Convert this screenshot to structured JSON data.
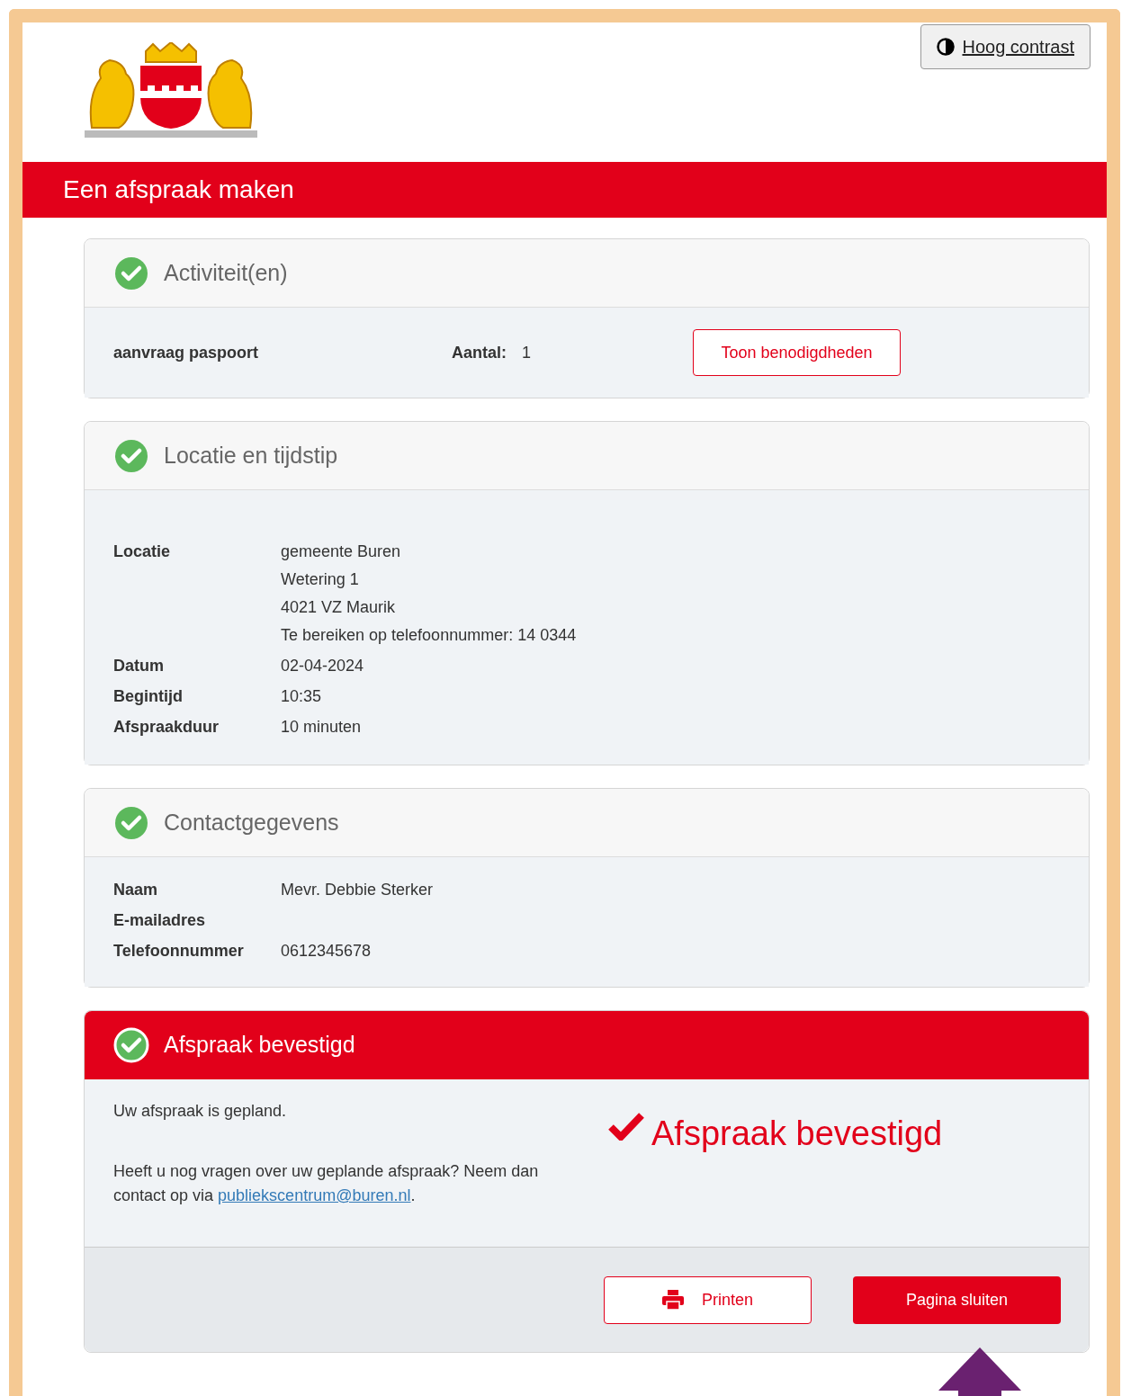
{
  "header": {
    "contrast_button": "Hoog contrast",
    "title": "Een afspraak maken"
  },
  "activity": {
    "title": "Activiteit(en)",
    "done": true,
    "items": [
      {
        "name": "aanvraag paspoort",
        "count_label": "Aantal:",
        "count": "1",
        "button": "Toon benodigdheden"
      }
    ]
  },
  "location": {
    "title": "Locatie en tijdstip",
    "done": true,
    "rows": [
      {
        "label": "Locatie",
        "lines": [
          "gemeente Buren",
          "Wetering 1",
          "4021 VZ Maurik",
          "Te bereiken op telefoonnummer: 14 0344"
        ]
      },
      {
        "label": "Datum",
        "lines": [
          "02-04-2024"
        ]
      },
      {
        "label": "Begintijd",
        "lines": [
          "10:35"
        ]
      },
      {
        "label": "Afspraakduur",
        "lines": [
          "10 minuten"
        ]
      }
    ]
  },
  "contact": {
    "title": "Contactgegevens",
    "done": true,
    "rows": [
      {
        "label": "Naam",
        "lines": [
          "Mevr. Debbie Sterker"
        ]
      },
      {
        "label": "E-mailadres",
        "lines": []
      },
      {
        "label": "Telefoonnummer",
        "lines": [
          "0612345678"
        ]
      }
    ]
  },
  "confirmation": {
    "title": "Afspraak bevestigd",
    "done": true,
    "message": "Uw afspraak is gepland.",
    "question": "Heeft u nog vragen over uw geplande afspraak? Neem dan contact op via ",
    "link": "publiekscentrum@buren.nl",
    "question_end": ".",
    "stamp": "Afspraak bevestigd",
    "buttons": [
      {
        "label": "Printen",
        "kind": "outline"
      },
      {
        "label": "Pagina sluiten",
        "kind": "primary"
      }
    ]
  }
}
